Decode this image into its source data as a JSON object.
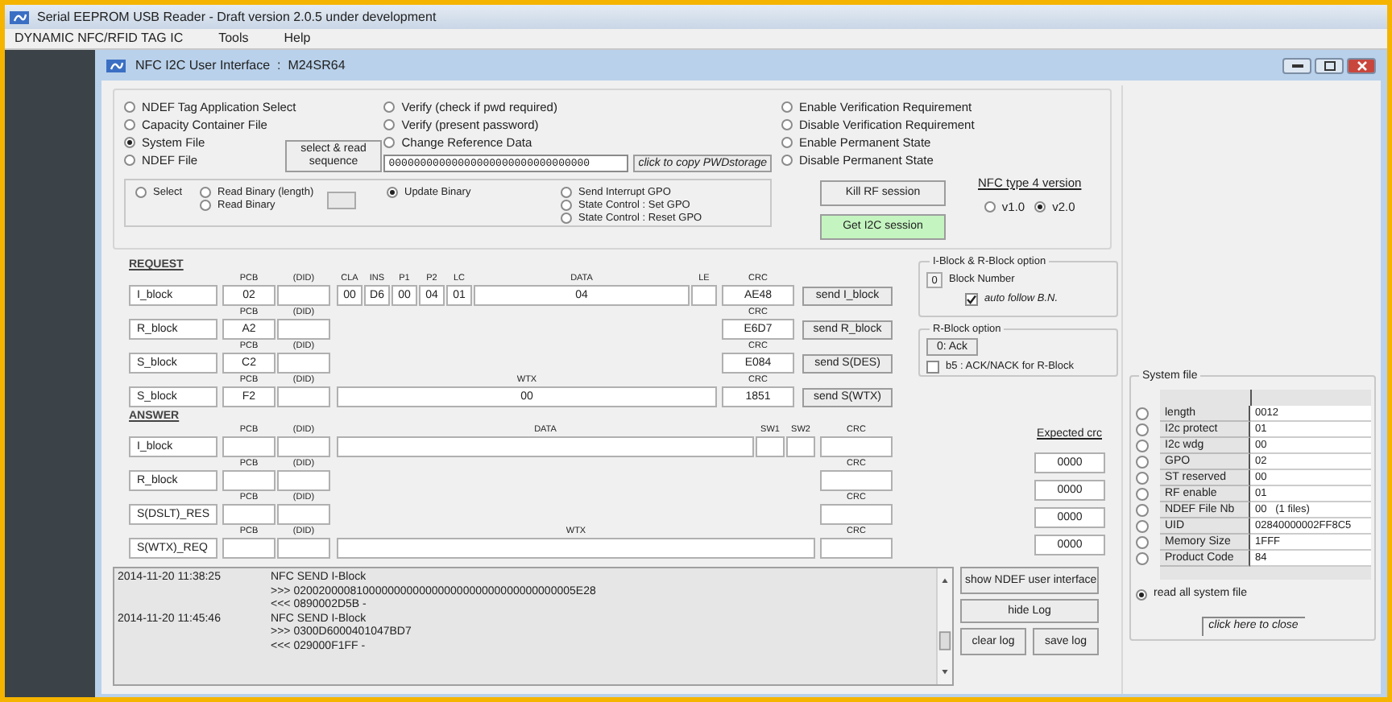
{
  "window": {
    "title": "Serial EEPROM USB Reader - Draft version 2.0.5 under development"
  },
  "menu": [
    "DYNAMIC NFC/RFID TAG IC",
    "Tools",
    "Help"
  ],
  "dialog": {
    "title": "NFC I2C User Interface  :  M24SR64"
  },
  "file_options": [
    {
      "label": "NDEF Tag Application Select",
      "selected": false
    },
    {
      "label": "Capacity Container File",
      "selected": false
    },
    {
      "label": "System File",
      "selected": true
    },
    {
      "label": "NDEF File",
      "selected": false
    }
  ],
  "sequence_button": "select & read sequence",
  "password_options": [
    {
      "label": "Verify (check if pwd required)",
      "selected": false
    },
    {
      "label": "Verify (present password)",
      "selected": false
    },
    {
      "label": "Change Reference Data",
      "selected": false
    }
  ],
  "password_field": {
    "value": "00000000000000000000000000000000"
  },
  "copy_button": "click to copy PWDstorage",
  "commands": [
    [
      {
        "label": "Select",
        "selected": false
      }
    ],
    [
      {
        "label": "Read Binary (length)",
        "selected": false
      },
      {
        "label": "Read Binary",
        "selected": false
      }
    ],
    [
      {
        "label": "Update Binary",
        "selected": true
      }
    ],
    [
      {
        "label": "Send Interrupt GPO",
        "selected": false
      },
      {
        "label": "State Control : Set GPO",
        "selected": false
      },
      {
        "label": "State Control : Reset GPO",
        "selected": false
      }
    ]
  ],
  "state_options": [
    {
      "label": "Enable Verification Requirement",
      "selected": false
    },
    {
      "label": "Disable Verification Requirement",
      "selected": false
    },
    {
      "label": "Enable Permanent State",
      "selected": false
    },
    {
      "label": "Disable Permanent State",
      "selected": false
    }
  ],
  "session_buttons": [
    {
      "label": "Kill RF session",
      "active": false
    },
    {
      "label": "Get I2C session",
      "active": true
    }
  ],
  "nfc_version": {
    "title": "NFC type 4 version",
    "options": [
      {
        "label": "v1.0",
        "selected": false
      },
      {
        "label": "v2.0",
        "selected": true
      }
    ]
  },
  "request": {
    "title": "REQUEST",
    "rows": [
      {
        "name": "I_block",
        "fields": [
          {
            "kind": "pcb",
            "header": "PCB",
            "value": "02"
          },
          {
            "kind": "did",
            "header": "(DID)"
          },
          {
            "kind": "byte",
            "header": "CLA",
            "value": "00"
          },
          {
            "kind": "byte",
            "header": "INS",
            "value": "D6"
          },
          {
            "kind": "byte",
            "header": "P1",
            "value": "00"
          },
          {
            "kind": "byte",
            "header": "P2",
            "value": "04"
          },
          {
            "kind": "byte",
            "header": "LC",
            "value": "01"
          },
          {
            "kind": "data",
            "header": "DATA",
            "value": "04"
          },
          {
            "kind": "le",
            "header": "LE"
          },
          {
            "kind": "crc",
            "header": "CRC",
            "value": "AE48"
          }
        ],
        "button": "send I_block"
      },
      {
        "name": "R_block",
        "fields": [
          {
            "kind": "pcb",
            "header": "PCB",
            "value": "A2"
          },
          {
            "kind": "did",
            "header": "(DID)"
          },
          {
            "kind": "crc",
            "header": "CRC",
            "value": "E6D7"
          }
        ],
        "button": "send R_block"
      },
      {
        "name": "S_block",
        "fields": [
          {
            "kind": "pcb",
            "header": "PCB",
            "value": "C2"
          },
          {
            "kind": "did",
            "header": "(DID)"
          },
          {
            "kind": "crc",
            "header": "CRC",
            "value": "E084"
          }
        ],
        "button": "send S(DES)"
      },
      {
        "name": "S_block",
        "fields": [
          {
            "kind": "pcb",
            "header": "PCB",
            "value": "F2"
          },
          {
            "kind": "did",
            "header": "(DID)"
          },
          {
            "kind": "data",
            "header": "WTX",
            "value": "00"
          },
          {
            "kind": "crc",
            "header": "CRC",
            "value": "1851"
          }
        ],
        "button": "send S(WTX)"
      }
    ]
  },
  "block_options": {
    "title": "I-Block & R-Block option",
    "block_number": "0",
    "block_number_label": "Block Number",
    "auto_follow": {
      "label": "auto follow B.N.",
      "checked": true
    }
  },
  "r_block_option": {
    "title": "R-Block option",
    "button": "0: Ack",
    "nack": {
      "label": "b5 : ACK/NACK for R-Block",
      "checked": false
    }
  },
  "answer": {
    "title": "ANSWER",
    "rows": [
      {
        "name": "I_block",
        "fields": [
          {
            "kind": "pcb",
            "header": "PCB"
          },
          {
            "kind": "did",
            "header": "(DID)"
          },
          {
            "kind": "data",
            "header": "DATA"
          },
          {
            "kind": "sw",
            "header": "SW1"
          },
          {
            "kind": "sw",
            "header": "SW2"
          },
          {
            "kind": "crc",
            "header": "CRC"
          }
        ]
      },
      {
        "name": "R_block",
        "fields": [
          {
            "kind": "pcb",
            "header": "PCB"
          },
          {
            "kind": "did",
            "header": "(DID)"
          },
          {
            "kind": "crc",
            "header": "CRC"
          }
        ]
      },
      {
        "name": "S(DSLT)_RES",
        "fields": [
          {
            "kind": "pcb",
            "header": "PCB"
          },
          {
            "kind": "did",
            "header": "(DID)"
          },
          {
            "kind": "crc",
            "header": "CRC"
          }
        ]
      },
      {
        "name": "S(WTX)_REQ",
        "fields": [
          {
            "kind": "pcb",
            "header": "PCB"
          },
          {
            "kind": "did",
            "header": "(DID)"
          },
          {
            "kind": "data",
            "header": "WTX"
          },
          {
            "kind": "crc",
            "header": "CRC"
          }
        ]
      }
    ]
  },
  "expected_crc": {
    "title": "Expected crc",
    "values": [
      "0000",
      "0000",
      "0000",
      "0000"
    ]
  },
  "log": {
    "entries": [
      {
        "time": "2014-11-20 11:38:25",
        "lines": [
          "NFC SEND I-Block",
          ">>> 020020000810000000000000000000000000000000005E28",
          "<<< 0890002D5B -"
        ]
      },
      {
        "time": "2014-11-20 11:45:46",
        "lines": [
          "NFC SEND I-Block",
          ">>> 0300D6000401047BD7",
          "<<< 029000F1FF -"
        ]
      }
    ]
  },
  "log_buttons": [
    "show NDEF user interface",
    "hide Log",
    "clear log",
    "save log"
  ],
  "system_file": {
    "title": "System file",
    "rows": [
      {
        "name": "length",
        "value": "0012",
        "selected": false
      },
      {
        "name": "I2c protect",
        "value": "01",
        "selected": false
      },
      {
        "name": "I2c wdg",
        "value": "00",
        "selected": false
      },
      {
        "name": "GPO",
        "value": "02",
        "selected": false
      },
      {
        "name": "ST reserved",
        "value": "00",
        "selected": false
      },
      {
        "name": "RF enable",
        "value": "01",
        "selected": false
      },
      {
        "name": "NDEF File Nb",
        "value": "00   (1 files)",
        "selected": false
      },
      {
        "name": "UID",
        "value": "02840000002FF8C5",
        "selected": false
      },
      {
        "name": "Memory Size",
        "value": "1FFF",
        "selected": false
      },
      {
        "name": "Product Code",
        "value": "84",
        "selected": false
      }
    ],
    "read_all": {
      "label": "read all system file",
      "selected": true
    },
    "close_button": "click here to close"
  }
}
